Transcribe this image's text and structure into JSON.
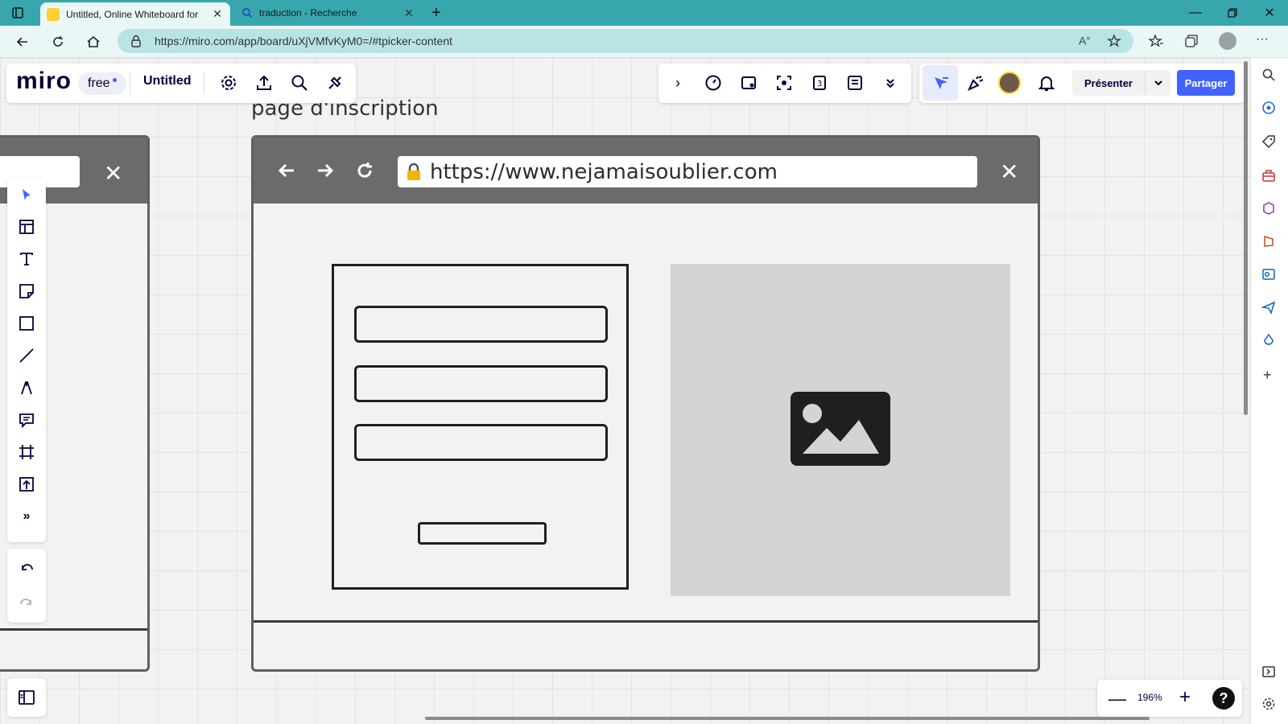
{
  "browser": {
    "tabs": [
      {
        "title": "Untitled, Online Whiteboard for",
        "active": true,
        "favicon": "miro-favicon"
      },
      {
        "title": "traduction - Recherche",
        "active": false,
        "favicon": "search-favicon"
      }
    ],
    "url": "https://miro.com/app/board/uXjVMfvKyM0=/#tpicker-content"
  },
  "toolbar": {
    "logo": "miro",
    "plan_badge": "free",
    "board_title": "Untitled",
    "present_label": "Présenter",
    "share_label": "Partager"
  },
  "canvas": {
    "frame_title": "page d'inscription",
    "mock_url": "https://www.nejamaisoublier.com"
  },
  "zoom": {
    "level": "196%",
    "help": "?"
  },
  "colors": {
    "accent": "#4262ff",
    "tabbar": "#37a7ad",
    "miro_yellow": "#ffd02f"
  }
}
